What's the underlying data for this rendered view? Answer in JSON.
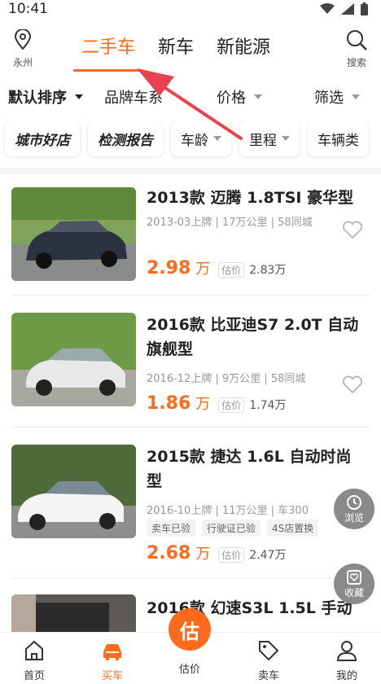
{
  "status": {
    "time": "10:41"
  },
  "topnav": {
    "location": "永州",
    "tabs": [
      "二手车",
      "新车",
      "新能源"
    ],
    "search_label": "搜索"
  },
  "sort": {
    "default": "默认排序",
    "brand": "品牌车系",
    "price": "价格",
    "filter": "筛选"
  },
  "chips": [
    "城市好店",
    "检测报告",
    "车龄",
    "里程",
    "车辆类"
  ],
  "cars": [
    {
      "title": "2013款 迈腾 1.8TSI 豪华型",
      "meta": "2013-03上牌 | 17万公里 | 58同城",
      "price": "2.98",
      "unit": "万",
      "est_tag": "估价",
      "est": "2.83万"
    },
    {
      "title": "2016款 比亚迪S7 2.0T 自动旗舰型",
      "meta": "2016-12上牌 | 9万公里 | 58同城",
      "price": "1.86",
      "unit": "万",
      "est_tag": "估价",
      "est": "1.74万"
    },
    {
      "title": "2015款 捷达 1.6L 自动时尚型",
      "meta": "2016-10上牌 | 11万公里 | 车300",
      "badges": [
        "卖车已验",
        "行驶证已验",
        "4S店置换"
      ],
      "price": "2.68",
      "unit": "万",
      "est_tag": "估价",
      "est": "2.47万"
    },
    {
      "title": "2016款 幻速S3L 1.5L 手动"
    }
  ],
  "float": {
    "history": "浏览",
    "fav": "收藏"
  },
  "bottomnav": {
    "home": "首页",
    "buy": "买车",
    "estimate": "估价",
    "estimate_icon": "估",
    "sell": "卖车",
    "mine": "我的"
  },
  "colors": {
    "accent": "#ff6a1b",
    "annotation_arrow": "#e8424f"
  }
}
